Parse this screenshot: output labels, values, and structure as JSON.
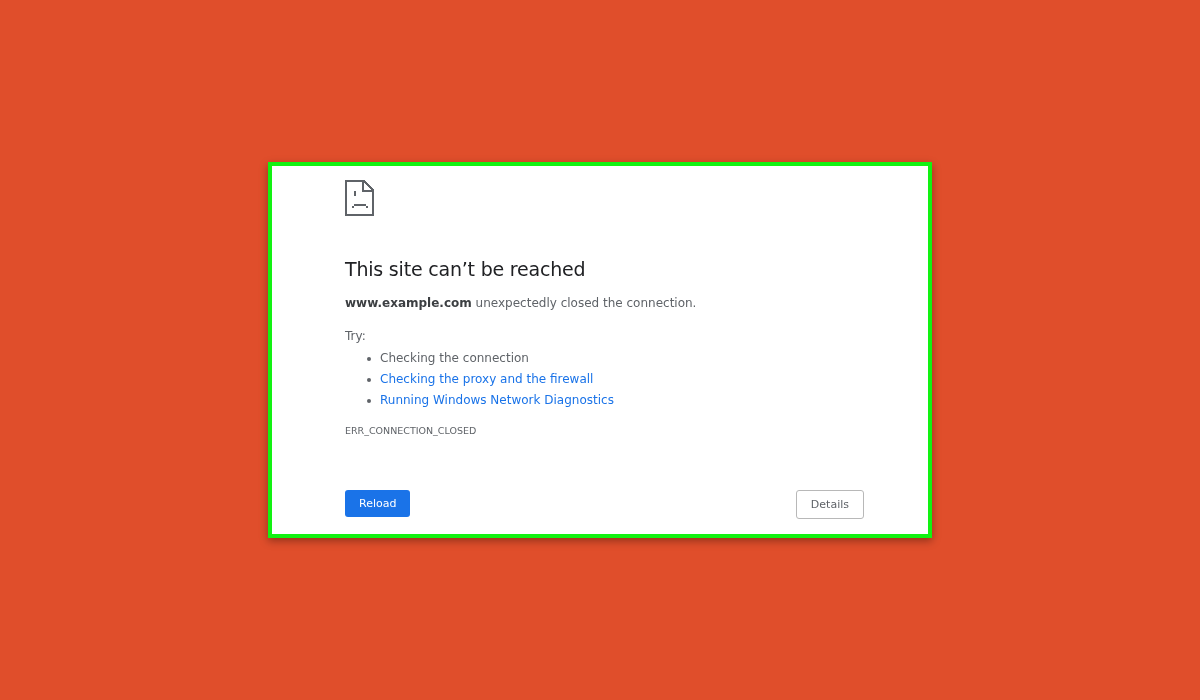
{
  "error_page": {
    "title": "This site can’t be reached",
    "description": "**www.example.com** unexpectedly closed the connection.",
    "try_label": "Try:",
    "suggestions": [
      {
        "kind": "text",
        "label": "Checking the connection"
      },
      {
        "kind": "link",
        "label": "Checking the proxy and the firewall"
      },
      {
        "kind": "link",
        "label": "Running Windows Network Diagnostics"
      }
    ],
    "error_code": "ERR_CONNECTION_CLOSED",
    "buttons": [
      {
        "kind": "primary",
        "label": "Reload"
      },
      {
        "kind": "secondary",
        "label": "Details"
      }
    ]
  }
}
